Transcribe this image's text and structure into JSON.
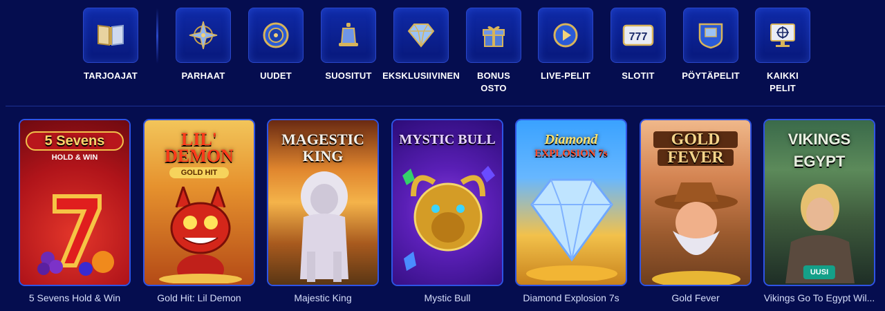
{
  "categories": [
    {
      "label": "TARJOAJAT",
      "icon": "book-icon"
    },
    {
      "label": "PARHAAT",
      "icon": "compass-star-icon"
    },
    {
      "label": "UUDET",
      "icon": "chip-icon"
    },
    {
      "label": "SUOSITUT",
      "icon": "bell-icon"
    },
    {
      "label": "EKSKLUSIIVINEN",
      "icon": "diamond-icon"
    },
    {
      "label": "BONUS\nOSTO",
      "icon": "gift-icon"
    },
    {
      "label": "LIVE-PELIT",
      "icon": "play-icon"
    },
    {
      "label": "SLOTIT",
      "icon": "slot-777-icon"
    },
    {
      "label": "PÖYTÄPELIT",
      "icon": "table-badge-icon"
    },
    {
      "label": "KAIKKI\nPELIT",
      "icon": "monitor-wheel-icon"
    }
  ],
  "games": [
    {
      "name": "5 Sevens Hold & Win",
      "art_title": "5 Sevens",
      "art_sub": "HOLD & WIN"
    },
    {
      "name": "Gold Hit: Lil Demon",
      "art_title": "LIL' DEMON",
      "art_sub": "GOLD HIT"
    },
    {
      "name": "Majestic King",
      "art_title": "MAGESTIC",
      "art_sub": "KING"
    },
    {
      "name": "Mystic Bull",
      "art_title": "MYSTIC BULL",
      "art_sub": ""
    },
    {
      "name": "Diamond Explosion 7s",
      "art_title": "Diamond",
      "art_sub": "EXPLOSION 7s"
    },
    {
      "name": "Gold Fever",
      "art_title": "GOLD",
      "art_sub": "FEVER"
    },
    {
      "name": "Vikings Go To Egypt Wil...",
      "art_title": "VIKINGS",
      "art_sub": "EGYPT",
      "badge": "UUSI"
    }
  ],
  "colors": {
    "background": "#050d4f",
    "tile": "#0f2aa8",
    "card_border": "#2f54e6",
    "badge": "#14a089"
  }
}
